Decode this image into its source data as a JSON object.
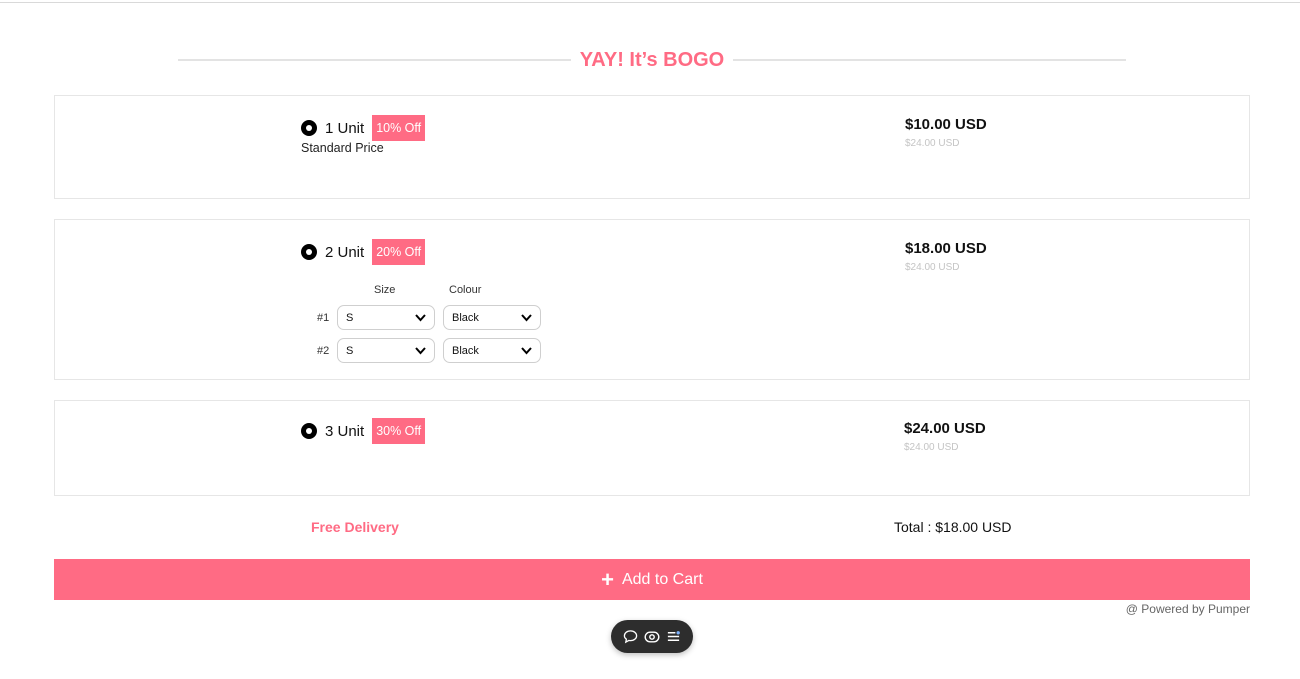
{
  "heading": "YAY! It’s BOGO",
  "options": [
    {
      "unit_label": "1 Unit",
      "badge": "10% Off",
      "subtitle": "Standard Price",
      "price": "$10.00 USD",
      "compare_price": "$24.00 USD"
    },
    {
      "unit_label": "2 Unit",
      "badge": "20% Off",
      "price": "$18.00 USD",
      "compare_price": "$24.00 USD",
      "variant_headers": {
        "size": "Size",
        "colour": "Colour"
      },
      "variants": [
        {
          "label": "#1",
          "size": "S",
          "colour": "Black"
        },
        {
          "label": "#2",
          "size": "S",
          "colour": "Black"
        }
      ]
    },
    {
      "unit_label": "3 Unit",
      "badge": "30% Off",
      "price": "$24.00 USD",
      "compare_price": "$24.00 USD"
    }
  ],
  "footer": {
    "free_delivery": "Free Delivery",
    "total": "Total : $18.00 USD",
    "add_to_cart": "Add to Cart",
    "add_icon": "plus-icon",
    "powered_by": "@ Powered by Pumper"
  },
  "toolbar_icons": [
    "comment-icon",
    "eye-icon",
    "list-settings-icon"
  ],
  "colors": {
    "accent": "#ff6b84",
    "toolbar_bg": "#2d2d2d"
  }
}
